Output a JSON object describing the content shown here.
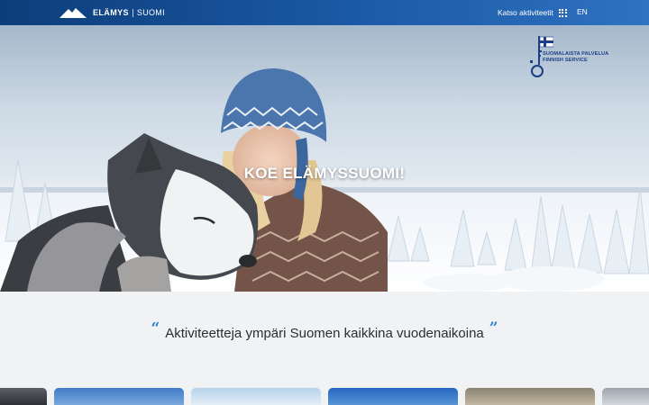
{
  "header": {
    "brand": "ELÄMYS",
    "brand_sub": "SUOMI",
    "activities_label": "Katso aktiviteetit",
    "language": "EN"
  },
  "hero": {
    "title": "KOE ELÄMYSSUOMI!",
    "badge_lines": [
      "SUOMALAISTA PALVELUA",
      "FINNISH SERVICE"
    ]
  },
  "tagline": "Aktiviteetteja ympäri Suomen kaikkina vuodenaikoina",
  "cards": [
    {
      "color": "#3a3d44"
    },
    {
      "color": "#4a82c9"
    },
    {
      "color": "#c9dcec"
    },
    {
      "color": "#2f6fc4"
    },
    {
      "color": "#7f7a6e"
    },
    {
      "color": "#b9bec6"
    }
  ]
}
